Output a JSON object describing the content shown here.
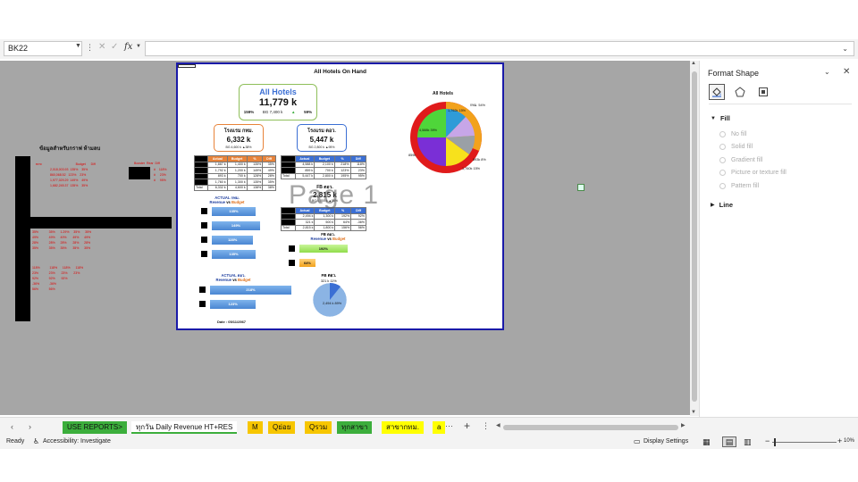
{
  "formula_bar": {
    "name_box": "BK22",
    "fx": "fx"
  },
  "page": {
    "title": "All Hotels On Hand",
    "watermark": "Page 1",
    "all_hotels": {
      "title": "All Hotels",
      "value": "11,779 k",
      "pct": "159%",
      "bg": "BG 7,400 k",
      "diff": "59%"
    },
    "hotel1": {
      "name": "โรงแรม กทม.",
      "value": "6,332 k",
      "sub": "BG 4,600 k ▲38%"
    },
    "hotel2": {
      "name": "โรงแรม ตอว.",
      "value": "5,447 k",
      "sub": "BG 2,800 k ▲95%"
    },
    "table1": {
      "headers": [
        "",
        "Actual",
        "Budget",
        "%",
        "Diff"
      ],
      "rows": [
        [
          "",
          "1,887 k",
          "1,400 k",
          "135%",
          "35%"
        ],
        [
          "",
          "1,792 k",
          "1,200 k",
          "149%",
          "49%"
        ],
        [
          "",
          "893 k",
          "700 k",
          "128%",
          "28%"
        ],
        [
          "",
          "1,760 k",
          "1,300 k",
          "135%",
          "35%"
        ],
        [
          "Total",
          "6,332 k",
          "4,600 k",
          "138%",
          "38%"
        ]
      ]
    },
    "table2": {
      "headers": [
        "",
        "Actual",
        "Budget",
        "%",
        "Diff"
      ],
      "rows": [
        [
          "",
          "4,588 k",
          "2,100 k",
          "218%",
          "118%"
        ],
        [
          "",
          "859 k",
          "700 k",
          "123%",
          "23%"
        ],
        [
          "Total",
          "5,447 k",
          "2,800 k",
          "195%",
          "95%"
        ]
      ]
    },
    "fb_small": {
      "label": "FB ตอว.",
      "value": "2,815 k",
      "sub": "BG 1,800 k ▲56%"
    },
    "table3": {
      "headers": [
        "",
        "Actual",
        "Budget",
        "%",
        "Diff"
      ],
      "rows": [
        [
          "",
          "2,494 k",
          "1,300 k",
          "192%",
          "92%"
        ],
        [
          "",
          "321 k",
          "500 k",
          "64%",
          "-36%"
        ],
        [
          "Total",
          "2,815 k",
          "1,800 k",
          "156%",
          "56%"
        ]
      ]
    },
    "section_actual_bkk": {
      "line1": "ACTUAL กทม.",
      "rev": "Revenue",
      "vs": "vs",
      "budget": "Budget"
    },
    "section_fb": {
      "line1": "FB ตอว.",
      "rev": "Revenue",
      "vs": "vs",
      "budget": "Budget"
    },
    "section_actual_prov": {
      "line1": "ACTUAL ตอว.",
      "rev": "Revenue",
      "vs": "vs",
      "budget": "Budget"
    },
    "bars_bkk": [
      "135%",
      "149%",
      "128%",
      "135%"
    ],
    "bars_fb": [
      "192%",
      "64%"
    ],
    "bars_prov": [
      "218%",
      "123%"
    ],
    "pie1_title": "All Hotels",
    "pie1_labels": [
      "กทม. 54%",
      "4,588k 39%",
      "1,792k 15%",
      "893k 8%",
      "1,760k 15%",
      "859k"
    ],
    "pie2_title": "FB ตอว.",
    "pie2_small_label": "321 k 11%",
    "pie2_big_label": "2,494 k 89%",
    "date": "Date : 05/11/2567"
  },
  "left_area": {
    "title": "ข้อมูลสำหรับกราฟ ห้ามลบ"
  },
  "task_pane": {
    "title": "Format Shape",
    "fill_label": "Fill",
    "fill_options": [
      "No fill",
      "Solid fill",
      "Gradient fill",
      "Picture or texture fill",
      "Pattern fill"
    ],
    "line_label": "Line"
  },
  "sheet_tabs": [
    {
      "label": "USE REPORTS>",
      "color": "#3cae3c"
    },
    {
      "label": "ทุกวัน Daily Revenue HT+RES",
      "color": "#f7d4d4"
    },
    {
      "label": "M",
      "color": "#f7c600"
    },
    {
      "label": "Qย่อย",
      "color": "#f7c600"
    },
    {
      "label": "Qรวม",
      "color": "#f7c600"
    },
    {
      "label": "ทุกสาขา",
      "color": "#3cae3c"
    },
    {
      "label": "สาขากทม.",
      "color": "#ffff00"
    },
    {
      "label": "a",
      "color": "#ffff00"
    }
  ],
  "status_bar": {
    "ready": "Ready",
    "accessibility": "Accessibility: Investigate",
    "display_settings": "Display Settings",
    "zoom": "10%"
  },
  "colors": {
    "accent_blue": "#3b6fd4",
    "orange": "#e8833a",
    "green": "#8fbf5a",
    "page_border": "#1a1aa8"
  }
}
